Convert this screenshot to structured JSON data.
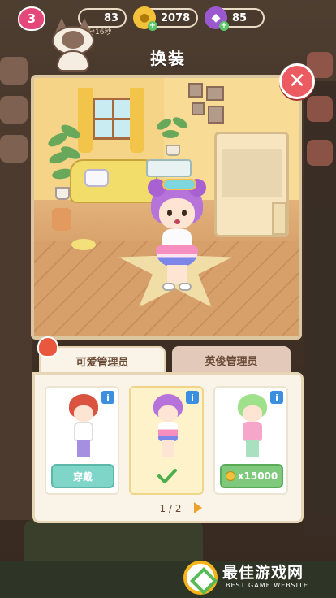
{
  "hud": {
    "level": "3",
    "timer_stat": "83",
    "timer_text": "分16秒",
    "coins": "2078",
    "gems": "85"
  },
  "dialog": {
    "title": "换装"
  },
  "tabs": [
    {
      "label": "可爱管理员",
      "active": true
    },
    {
      "label": "英俊管理员",
      "active": false
    }
  ],
  "cards": [
    {
      "name": "red-hair-overalls",
      "action": "穿戴",
      "state": "wear"
    },
    {
      "name": "purple-hair-star",
      "action": "",
      "state": "equipped"
    },
    {
      "name": "green-hair-surfer",
      "action": "x15000",
      "state": "buy"
    }
  ],
  "pager": {
    "text": "1 / 2"
  },
  "watermark": {
    "title": "最佳游戏网",
    "subtitle": "BEST GAME WEBSITE"
  },
  "colors": {
    "close": "#ec5a62",
    "wear_button": "#7fd6c8",
    "buy_button": "#7ec97b",
    "selected_card": "#fdf2c9",
    "info_badge": "#3b8fe0"
  }
}
